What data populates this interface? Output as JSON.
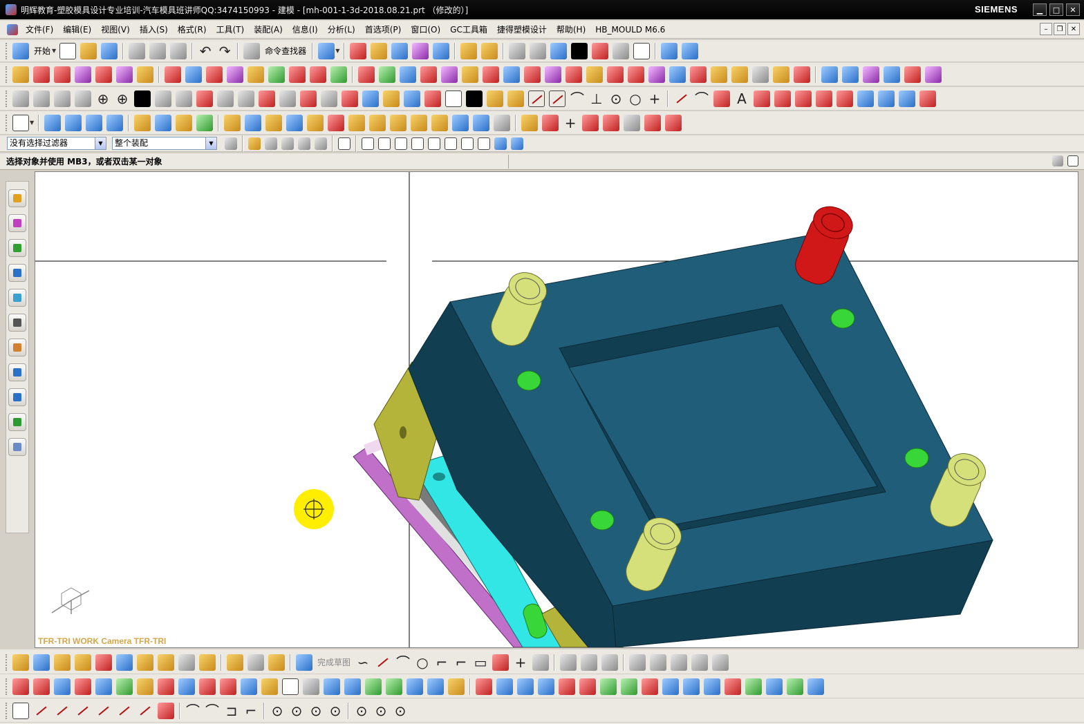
{
  "window": {
    "title": "明辉教育-塑胶模具设计专业培训-汽车模具班讲师QQ:3474150993 - 建模 - [mh-001-1-3d-2018.08.21.prt （修改的）]",
    "brand": "SIEMENS",
    "controls": {
      "minimize": "▁",
      "maximize": "□",
      "close": "✕"
    }
  },
  "menubar": {
    "items": [
      {
        "label": "文件(F)"
      },
      {
        "label": "编辑(E)"
      },
      {
        "label": "视图(V)"
      },
      {
        "label": "插入(S)"
      },
      {
        "label": "格式(R)"
      },
      {
        "label": "工具(T)"
      },
      {
        "label": "装配(A)"
      },
      {
        "label": "信息(I)"
      },
      {
        "label": "分析(L)"
      },
      {
        "label": "首选项(P)"
      },
      {
        "label": "窗口(O)"
      },
      {
        "label": "GC工具箱"
      },
      {
        "label": "捷得塑模设计"
      },
      {
        "label": "帮助(H)"
      },
      {
        "label": "HB_MOULD M6.6"
      }
    ],
    "doc_controls": {
      "minimize": "–",
      "restore": "❐",
      "close": "✕"
    }
  },
  "standard_toolbar": {
    "start_label": "开始",
    "command_finder_label": "命令查找器"
  },
  "filterbar": {
    "type_filter": "没有选择过滤器",
    "scope_filter": "整个装配"
  },
  "cue_line": {
    "text": "选择对象并使用 MB3，或者双击某一对象"
  },
  "viewport": {
    "view_label": "TFR-TRI WORK Camera TFR-TRI",
    "colors": {
      "plate_top": "#1f5d78",
      "plate_side": "#123e52",
      "guide_pin": "#d5e07a",
      "sprue_bushing": "#d01818",
      "holes": "#39d639",
      "insert_plate": "#33e6e6",
      "clamp_plate": "#b4b43a",
      "ejector_plate": "#c070c8",
      "cursor": "#ffee00"
    }
  },
  "bottom_toolbar": {
    "finish_sketch_label": "完成草图"
  }
}
